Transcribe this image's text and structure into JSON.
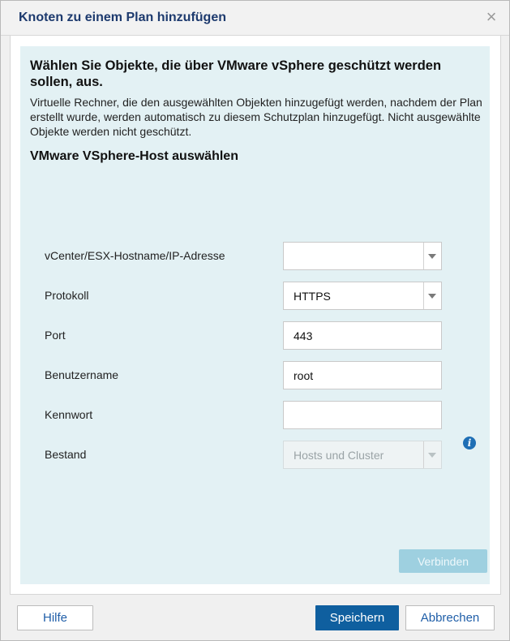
{
  "dialog": {
    "title": "Knoten zu einem Plan hinzufügen",
    "close_symbol": "×"
  },
  "panel": {
    "heading": "Wählen Sie Objekte, die über VMware vSphere geschützt werden sollen, aus.",
    "description": "Virtuelle Rechner, die den ausgewählten Objekten hinzugefügt werden, nachdem der Plan erstellt wurde, werden automatisch zu diesem Schutzplan hinzugefügt. Nicht ausgewählte Objekte werden nicht geschützt.",
    "subheading": "VMware VSphere-Host auswählen"
  },
  "form": {
    "host_label": "vCenter/ESX-Hostname/IP-Adresse",
    "host_value": "",
    "protocol_label": "Protokoll",
    "protocol_value": "HTTPS",
    "port_label": "Port",
    "port_value": "443",
    "username_label": "Benutzername",
    "username_value": "root",
    "password_label": "Kennwort",
    "password_value": "",
    "inventory_label": "Bestand",
    "inventory_value": "Hosts und Cluster",
    "info_icon": "info-icon",
    "info_symbol": "i",
    "connect_label": "Verbinden"
  },
  "footer": {
    "help_label": "Hilfe",
    "save_label": "Speichern",
    "cancel_label": "Abbrechen"
  },
  "colors": {
    "title": "#1d3a6e",
    "panel_bg": "#e3f1f4",
    "primary": "#0f5f9f",
    "connect_disabled": "#9ed0e0"
  }
}
